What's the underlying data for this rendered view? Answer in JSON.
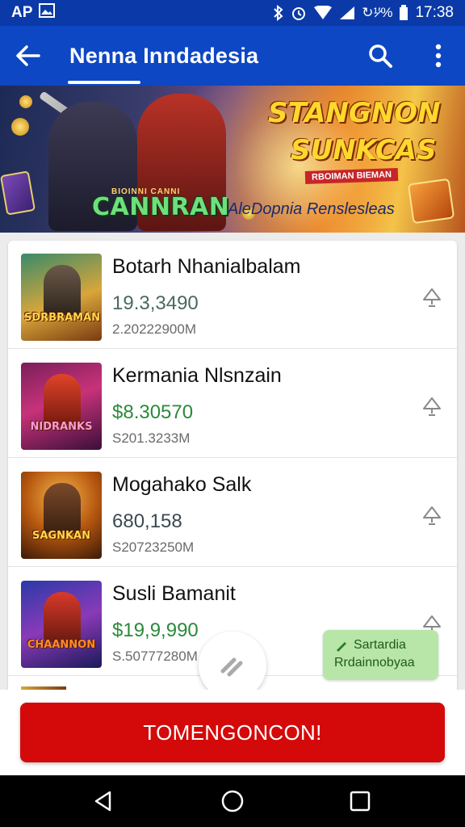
{
  "status_bar": {
    "left_text": "AP",
    "percent": "↻¹̷′%",
    "time": "17:38",
    "icons": [
      "image-icon",
      "bluetooth-icon",
      "alarm-icon",
      "wifi-icon",
      "signal-icon",
      "battery-icon"
    ]
  },
  "app_bar": {
    "title": "Nenna Inndadesia",
    "icons": [
      "back-arrow-icon",
      "search-icon",
      "more-vert-icon"
    ]
  },
  "banner": {
    "small_logo": "BIOINNI CANNI",
    "logo": "CANNRAN",
    "headline_line1": "STANGNON",
    "headline_line2": "SUNKCAS",
    "ribbon": "RBOIMAN BIEMAN",
    "tagline": "AleDopnia Renslesleas"
  },
  "games": [
    {
      "name": "Botarh Nhanialbalam",
      "price": "19.3,3490",
      "meta": "2.20222900M",
      "thumb_logo": "SDRBRAMAN",
      "price_color": "#4a6a5a"
    },
    {
      "name": "Kermania Nlsnzain",
      "price": "$8.30570",
      "meta": "S201.3233M",
      "thumb_logo": "NIDRANKS",
      "price_color": "#2a8a3a"
    },
    {
      "name": "Mogahako Salk",
      "price": "680,158",
      "meta": "S20723250M",
      "thumb_logo": "SAGNKAN",
      "price_color": "#3a4a50"
    },
    {
      "name": "Susli Bamanit",
      "price": "$19,9,990",
      "meta": "S.50777280M",
      "thumb_logo": "CHAANNON",
      "price_color": "#2a8a3a"
    }
  ],
  "chip": {
    "line1": "Sartardia",
    "line2": "Rrdainnobyaa"
  },
  "cta": {
    "label": "TOMENGONCON!"
  },
  "colors": {
    "status_bar": "#0b3aa8",
    "app_bar": "#0d47c4",
    "cta": "#d40a0a",
    "chip": "#b8e6a8"
  }
}
